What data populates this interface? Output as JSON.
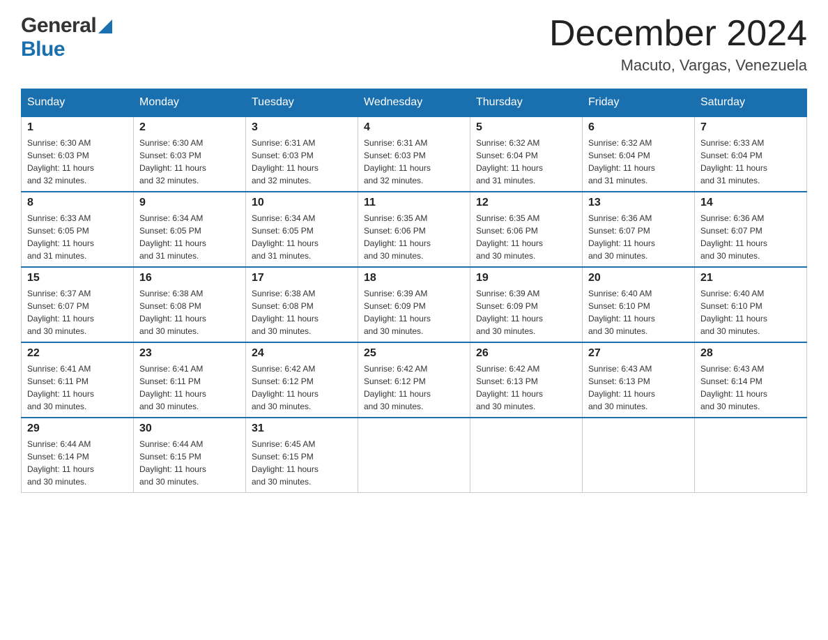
{
  "header": {
    "logo": {
      "general": "General",
      "blue": "Blue"
    },
    "title": "December 2024",
    "location": "Macuto, Vargas, Venezuela"
  },
  "calendar": {
    "days_of_week": [
      "Sunday",
      "Monday",
      "Tuesday",
      "Wednesday",
      "Thursday",
      "Friday",
      "Saturday"
    ],
    "weeks": [
      [
        {
          "day": "1",
          "sunrise": "6:30 AM",
          "sunset": "6:03 PM",
          "daylight": "11 hours and 32 minutes."
        },
        {
          "day": "2",
          "sunrise": "6:30 AM",
          "sunset": "6:03 PM",
          "daylight": "11 hours and 32 minutes."
        },
        {
          "day": "3",
          "sunrise": "6:31 AM",
          "sunset": "6:03 PM",
          "daylight": "11 hours and 32 minutes."
        },
        {
          "day": "4",
          "sunrise": "6:31 AM",
          "sunset": "6:03 PM",
          "daylight": "11 hours and 32 minutes."
        },
        {
          "day": "5",
          "sunrise": "6:32 AM",
          "sunset": "6:04 PM",
          "daylight": "11 hours and 31 minutes."
        },
        {
          "day": "6",
          "sunrise": "6:32 AM",
          "sunset": "6:04 PM",
          "daylight": "11 hours and 31 minutes."
        },
        {
          "day": "7",
          "sunrise": "6:33 AM",
          "sunset": "6:04 PM",
          "daylight": "11 hours and 31 minutes."
        }
      ],
      [
        {
          "day": "8",
          "sunrise": "6:33 AM",
          "sunset": "6:05 PM",
          "daylight": "11 hours and 31 minutes."
        },
        {
          "day": "9",
          "sunrise": "6:34 AM",
          "sunset": "6:05 PM",
          "daylight": "11 hours and 31 minutes."
        },
        {
          "day": "10",
          "sunrise": "6:34 AM",
          "sunset": "6:05 PM",
          "daylight": "11 hours and 31 minutes."
        },
        {
          "day": "11",
          "sunrise": "6:35 AM",
          "sunset": "6:06 PM",
          "daylight": "11 hours and 30 minutes."
        },
        {
          "day": "12",
          "sunrise": "6:35 AM",
          "sunset": "6:06 PM",
          "daylight": "11 hours and 30 minutes."
        },
        {
          "day": "13",
          "sunrise": "6:36 AM",
          "sunset": "6:07 PM",
          "daylight": "11 hours and 30 minutes."
        },
        {
          "day": "14",
          "sunrise": "6:36 AM",
          "sunset": "6:07 PM",
          "daylight": "11 hours and 30 minutes."
        }
      ],
      [
        {
          "day": "15",
          "sunrise": "6:37 AM",
          "sunset": "6:07 PM",
          "daylight": "11 hours and 30 minutes."
        },
        {
          "day": "16",
          "sunrise": "6:38 AM",
          "sunset": "6:08 PM",
          "daylight": "11 hours and 30 minutes."
        },
        {
          "day": "17",
          "sunrise": "6:38 AM",
          "sunset": "6:08 PM",
          "daylight": "11 hours and 30 minutes."
        },
        {
          "day": "18",
          "sunrise": "6:39 AM",
          "sunset": "6:09 PM",
          "daylight": "11 hours and 30 minutes."
        },
        {
          "day": "19",
          "sunrise": "6:39 AM",
          "sunset": "6:09 PM",
          "daylight": "11 hours and 30 minutes."
        },
        {
          "day": "20",
          "sunrise": "6:40 AM",
          "sunset": "6:10 PM",
          "daylight": "11 hours and 30 minutes."
        },
        {
          "day": "21",
          "sunrise": "6:40 AM",
          "sunset": "6:10 PM",
          "daylight": "11 hours and 30 minutes."
        }
      ],
      [
        {
          "day": "22",
          "sunrise": "6:41 AM",
          "sunset": "6:11 PM",
          "daylight": "11 hours and 30 minutes."
        },
        {
          "day": "23",
          "sunrise": "6:41 AM",
          "sunset": "6:11 PM",
          "daylight": "11 hours and 30 minutes."
        },
        {
          "day": "24",
          "sunrise": "6:42 AM",
          "sunset": "6:12 PM",
          "daylight": "11 hours and 30 minutes."
        },
        {
          "day": "25",
          "sunrise": "6:42 AM",
          "sunset": "6:12 PM",
          "daylight": "11 hours and 30 minutes."
        },
        {
          "day": "26",
          "sunrise": "6:42 AM",
          "sunset": "6:13 PM",
          "daylight": "11 hours and 30 minutes."
        },
        {
          "day": "27",
          "sunrise": "6:43 AM",
          "sunset": "6:13 PM",
          "daylight": "11 hours and 30 minutes."
        },
        {
          "day": "28",
          "sunrise": "6:43 AM",
          "sunset": "6:14 PM",
          "daylight": "11 hours and 30 minutes."
        }
      ],
      [
        {
          "day": "29",
          "sunrise": "6:44 AM",
          "sunset": "6:14 PM",
          "daylight": "11 hours and 30 minutes."
        },
        {
          "day": "30",
          "sunrise": "6:44 AM",
          "sunset": "6:15 PM",
          "daylight": "11 hours and 30 minutes."
        },
        {
          "day": "31",
          "sunrise": "6:45 AM",
          "sunset": "6:15 PM",
          "daylight": "11 hours and 30 minutes."
        },
        null,
        null,
        null,
        null
      ]
    ],
    "labels": {
      "sunrise": "Sunrise:",
      "sunset": "Sunset:",
      "daylight": "Daylight:"
    }
  }
}
